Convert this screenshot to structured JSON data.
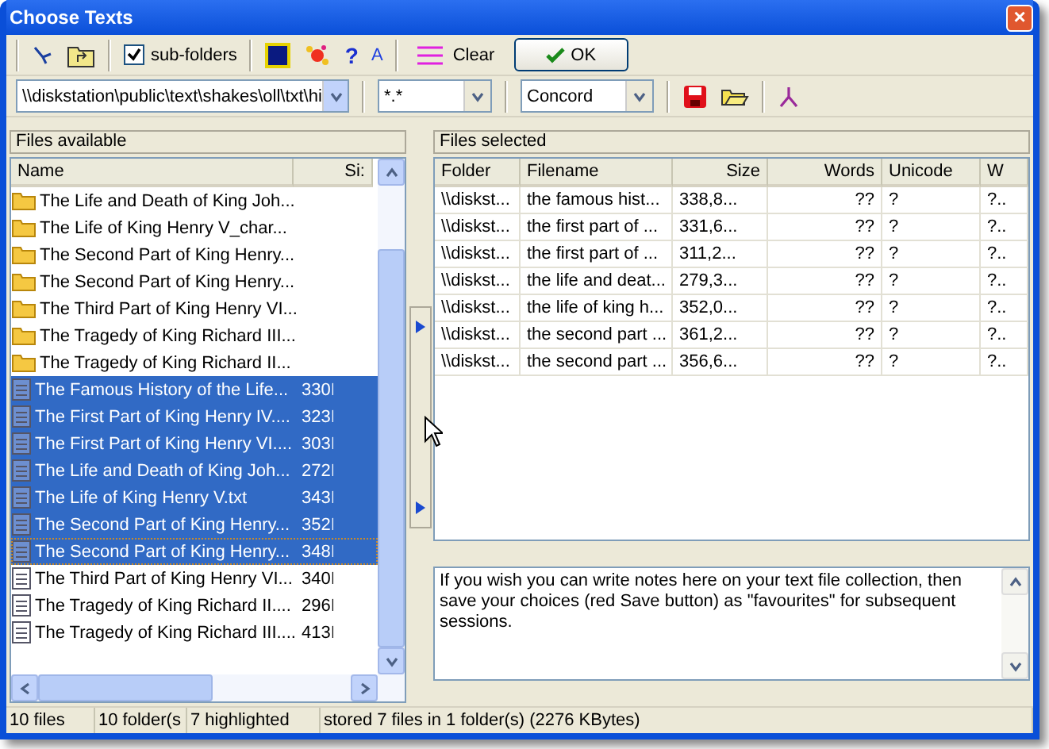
{
  "window": {
    "title": "Choose Texts",
    "close": "×"
  },
  "toolbar": {
    "subfolders": {
      "label": "sub-folders",
      "checked": true
    },
    "help": "?",
    "font": "A",
    "clear": "Clear",
    "ok": "OK"
  },
  "toolbar2": {
    "path": "\\\\diskstation\\public\\text\\shakes\\oll\\txt\\hi",
    "filter": "*.*",
    "mode": "Concord"
  },
  "files_available": {
    "title": "Files available",
    "columns": [
      "Name",
      "Si:"
    ],
    "rows": [
      {
        "kind": "folder",
        "name": "The Life and Death of King Joh...",
        "size": "",
        "selected": false,
        "focused": false
      },
      {
        "kind": "folder",
        "name": "The Life of King Henry V_char...",
        "size": "",
        "selected": false,
        "focused": false
      },
      {
        "kind": "folder",
        "name": "The Second Part of King Henry...",
        "size": "",
        "selected": false,
        "focused": false
      },
      {
        "kind": "folder",
        "name": "The Second Part of King Henry...",
        "size": "",
        "selected": false,
        "focused": false
      },
      {
        "kind": "folder",
        "name": "The Third Part of King Henry VI...",
        "size": "",
        "selected": false,
        "focused": false
      },
      {
        "kind": "folder",
        "name": "The Tragedy of King Richard III...",
        "size": "",
        "selected": false,
        "focused": false
      },
      {
        "kind": "folder",
        "name": "The Tragedy of King Richard II...",
        "size": "",
        "selected": false,
        "focused": false
      },
      {
        "kind": "file",
        "name": "The Famous History of the Life...",
        "size": "330I",
        "selected": true,
        "focused": false
      },
      {
        "kind": "file",
        "name": "The First Part of King Henry IV....",
        "size": "323I",
        "selected": true,
        "focused": false
      },
      {
        "kind": "file",
        "name": "The First Part of King Henry VI....",
        "size": "303I",
        "selected": true,
        "focused": false
      },
      {
        "kind": "file",
        "name": "The Life and Death of King Joh...",
        "size": "272I",
        "selected": true,
        "focused": false
      },
      {
        "kind": "file",
        "name": "The Life of King Henry V.txt",
        "size": "343I",
        "selected": true,
        "focused": false
      },
      {
        "kind": "file",
        "name": "The Second Part of King Henry...",
        "size": "352I",
        "selected": true,
        "focused": false
      },
      {
        "kind": "file",
        "name": "The Second Part of King Henry...",
        "size": "348I",
        "selected": true,
        "focused": true
      },
      {
        "kind": "file",
        "name": "The Third Part of King Henry VI...",
        "size": "340I",
        "selected": false,
        "focused": false
      },
      {
        "kind": "file",
        "name": "The Tragedy of King Richard II....",
        "size": "296I",
        "selected": false,
        "focused": false
      },
      {
        "kind": "file",
        "name": "The Tragedy of King Richard III....",
        "size": "413I",
        "selected": false,
        "focused": false
      }
    ]
  },
  "files_selected": {
    "title": "Files selected",
    "columns": [
      "Folder",
      "Filename",
      "Size",
      "Words",
      "Unicode",
      "W"
    ],
    "rows": [
      [
        "\\\\diskst...",
        "the famous hist...",
        "338,8...",
        "??",
        "?",
        "?.."
      ],
      [
        "\\\\diskst...",
        "the first part of ...",
        "331,6...",
        "??",
        "?",
        "?.."
      ],
      [
        "\\\\diskst...",
        "the first part of ...",
        "311,2...",
        "??",
        "?",
        "?.."
      ],
      [
        "\\\\diskst...",
        "the life and deat...",
        "279,3...",
        "??",
        "?",
        "?.."
      ],
      [
        "\\\\diskst...",
        "the life of king h...",
        "352,0...",
        "??",
        "?",
        "?.."
      ],
      [
        "\\\\diskst...",
        "the second part ...",
        "361,2...",
        "??",
        "?",
        "?.."
      ],
      [
        "\\\\diskst...",
        "the second part ...",
        "356,6...",
        "??",
        "?",
        "?.."
      ]
    ]
  },
  "notes": "If you wish you can write notes here on your text file collection, then save your choices (red Save button) as \"favourites\" for subsequent sessions.",
  "status_bar": [
    "10 files",
    "10 folder(s",
    "7 highlighted",
    "stored 7 files in 1 folder(s) (2276 KBytes)"
  ]
}
